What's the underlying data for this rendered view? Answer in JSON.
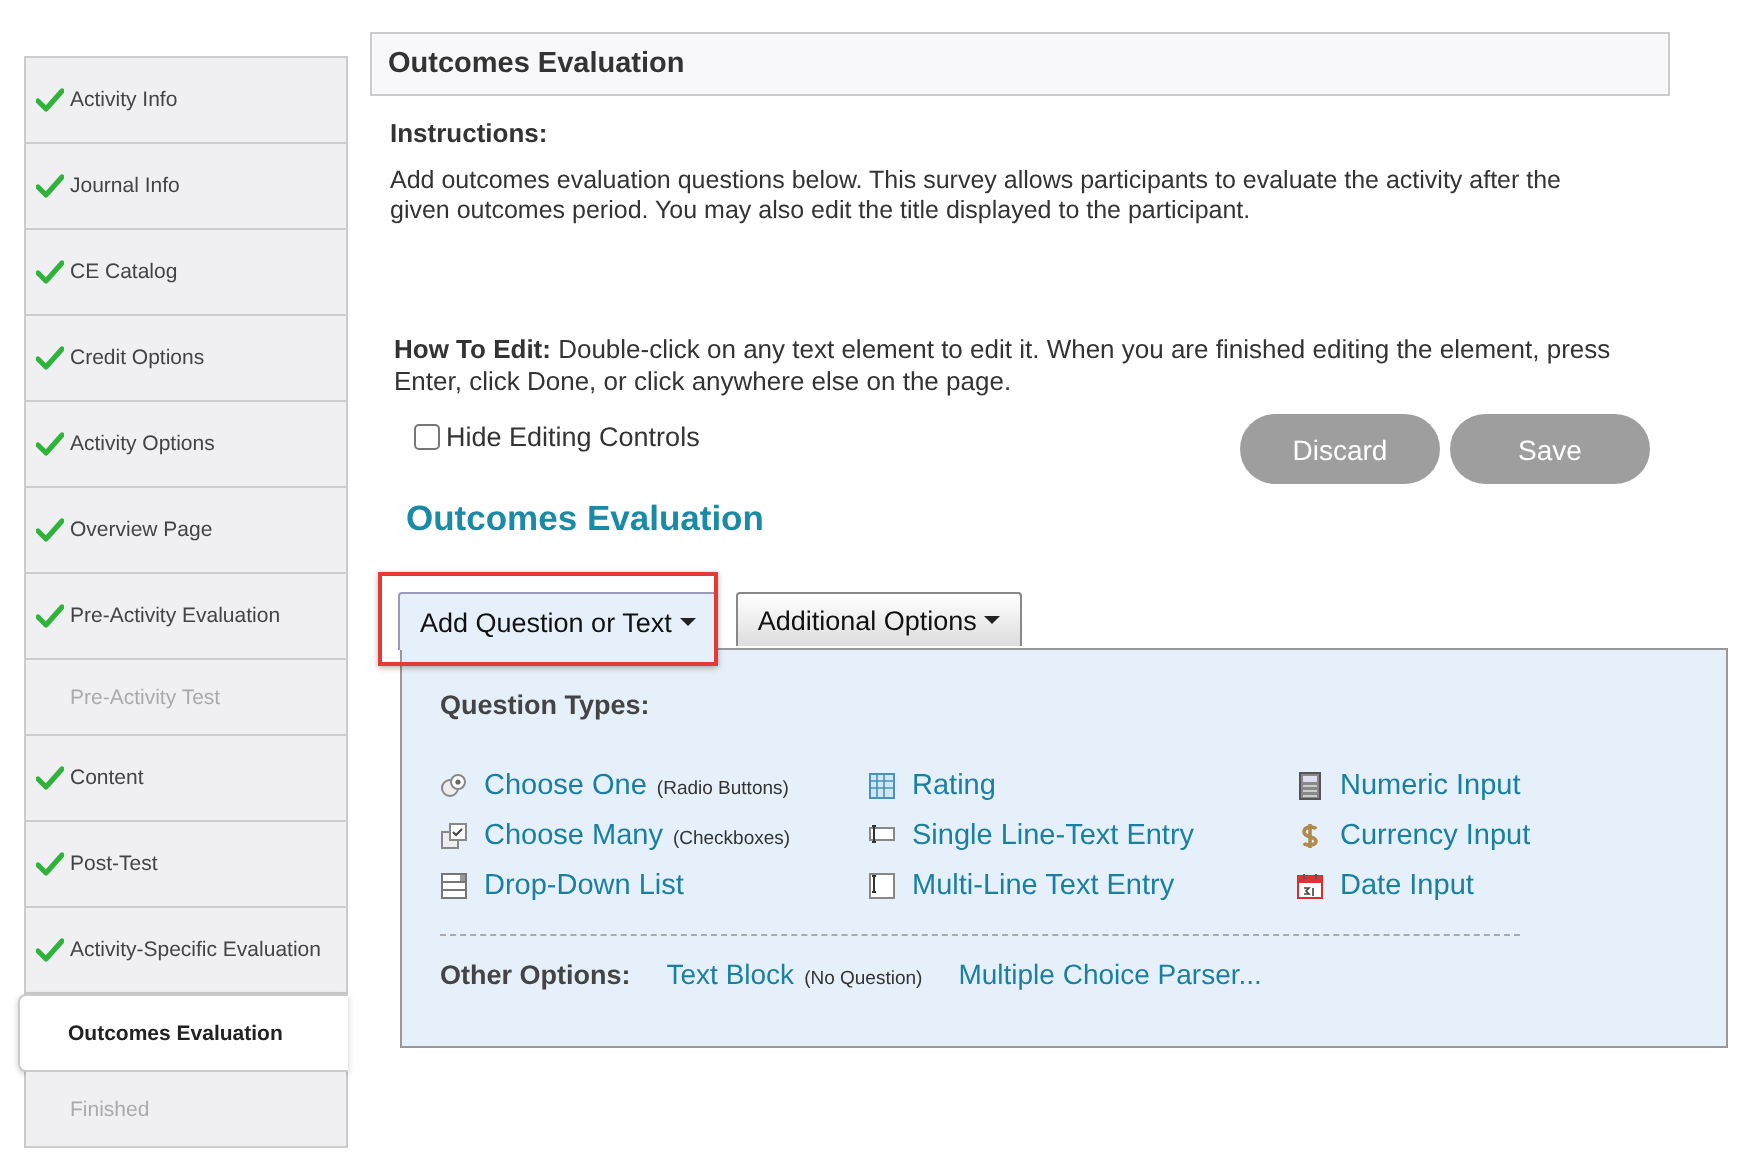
{
  "sidebar": {
    "items": [
      {
        "label": "Activity Info",
        "complete": true,
        "disabled": false,
        "selected": false
      },
      {
        "label": "Journal Info",
        "complete": true,
        "disabled": false,
        "selected": false
      },
      {
        "label": "CE Catalog",
        "complete": true,
        "disabled": false,
        "selected": false
      },
      {
        "label": "Credit Options",
        "complete": true,
        "disabled": false,
        "selected": false
      },
      {
        "label": "Activity Options",
        "complete": true,
        "disabled": false,
        "selected": false
      },
      {
        "label": "Overview Page",
        "complete": true,
        "disabled": false,
        "selected": false
      },
      {
        "label": "Pre-Activity Evaluation",
        "complete": true,
        "disabled": false,
        "selected": false
      },
      {
        "label": "Pre-Activity Test",
        "complete": false,
        "disabled": true,
        "selected": false
      },
      {
        "label": "Content",
        "complete": true,
        "disabled": false,
        "selected": false
      },
      {
        "label": "Post-Test",
        "complete": true,
        "disabled": false,
        "selected": false
      },
      {
        "label": "Activity-Specific Evaluation",
        "complete": true,
        "disabled": false,
        "selected": false
      },
      {
        "label": "Outcomes Evaluation",
        "complete": false,
        "disabled": false,
        "selected": true
      },
      {
        "label": "Finished",
        "complete": false,
        "disabled": true,
        "selected": false
      }
    ]
  },
  "header": {
    "title": "Outcomes Evaluation"
  },
  "instructions": {
    "heading": "Instructions:",
    "text": "Add outcomes evaluation questions below. This survey allows participants to evaluate the activity after the given outcomes period. You may also edit the title displayed to the participant."
  },
  "how_to_edit": "**How To Edit:** Double-click on any text element to edit it. When you are finished editing the element, press Enter, click Done, or click anywhere else on the page.",
  "hide_editing_controls": {
    "label": "Hide Editing Controls",
    "checked": false
  },
  "buttons": [
    {
      "label": "Discard",
      "disabled": true
    },
    {
      "label": "Save",
      "disabled": true
    }
  ],
  "evaluation_title": "Outcomes Evaluation",
  "tabs": [
    {
      "label": "Add Question or Text",
      "selected": true,
      "highlighted": true
    },
    {
      "label": "Additional Options",
      "selected": false,
      "highlighted": false
    }
  ],
  "panel": {
    "heading": "Question Types:",
    "columns": [
      [
        {
          "label": "Choose One",
          "note": "(Radio Buttons)"
        },
        {
          "label": "Choose Many",
          "note": "(Checkboxes)"
        },
        {
          "label": "Drop-Down List"
        }
      ],
      [
        {
          "label": "Rating"
        },
        {
          "label": "Single Line-Text Entry"
        },
        {
          "label": "Multi-Line Text Entry"
        }
      ],
      [
        {
          "label": "Numeric Input"
        },
        {
          "label": "Currency Input"
        },
        {
          "label": "Date Input"
        }
      ]
    ],
    "other_heading": "Other Options:",
    "other": [
      {
        "label": "Text Block",
        "note": "(No Question)"
      },
      {
        "label": "Multiple Choice Parser..."
      }
    ]
  }
}
